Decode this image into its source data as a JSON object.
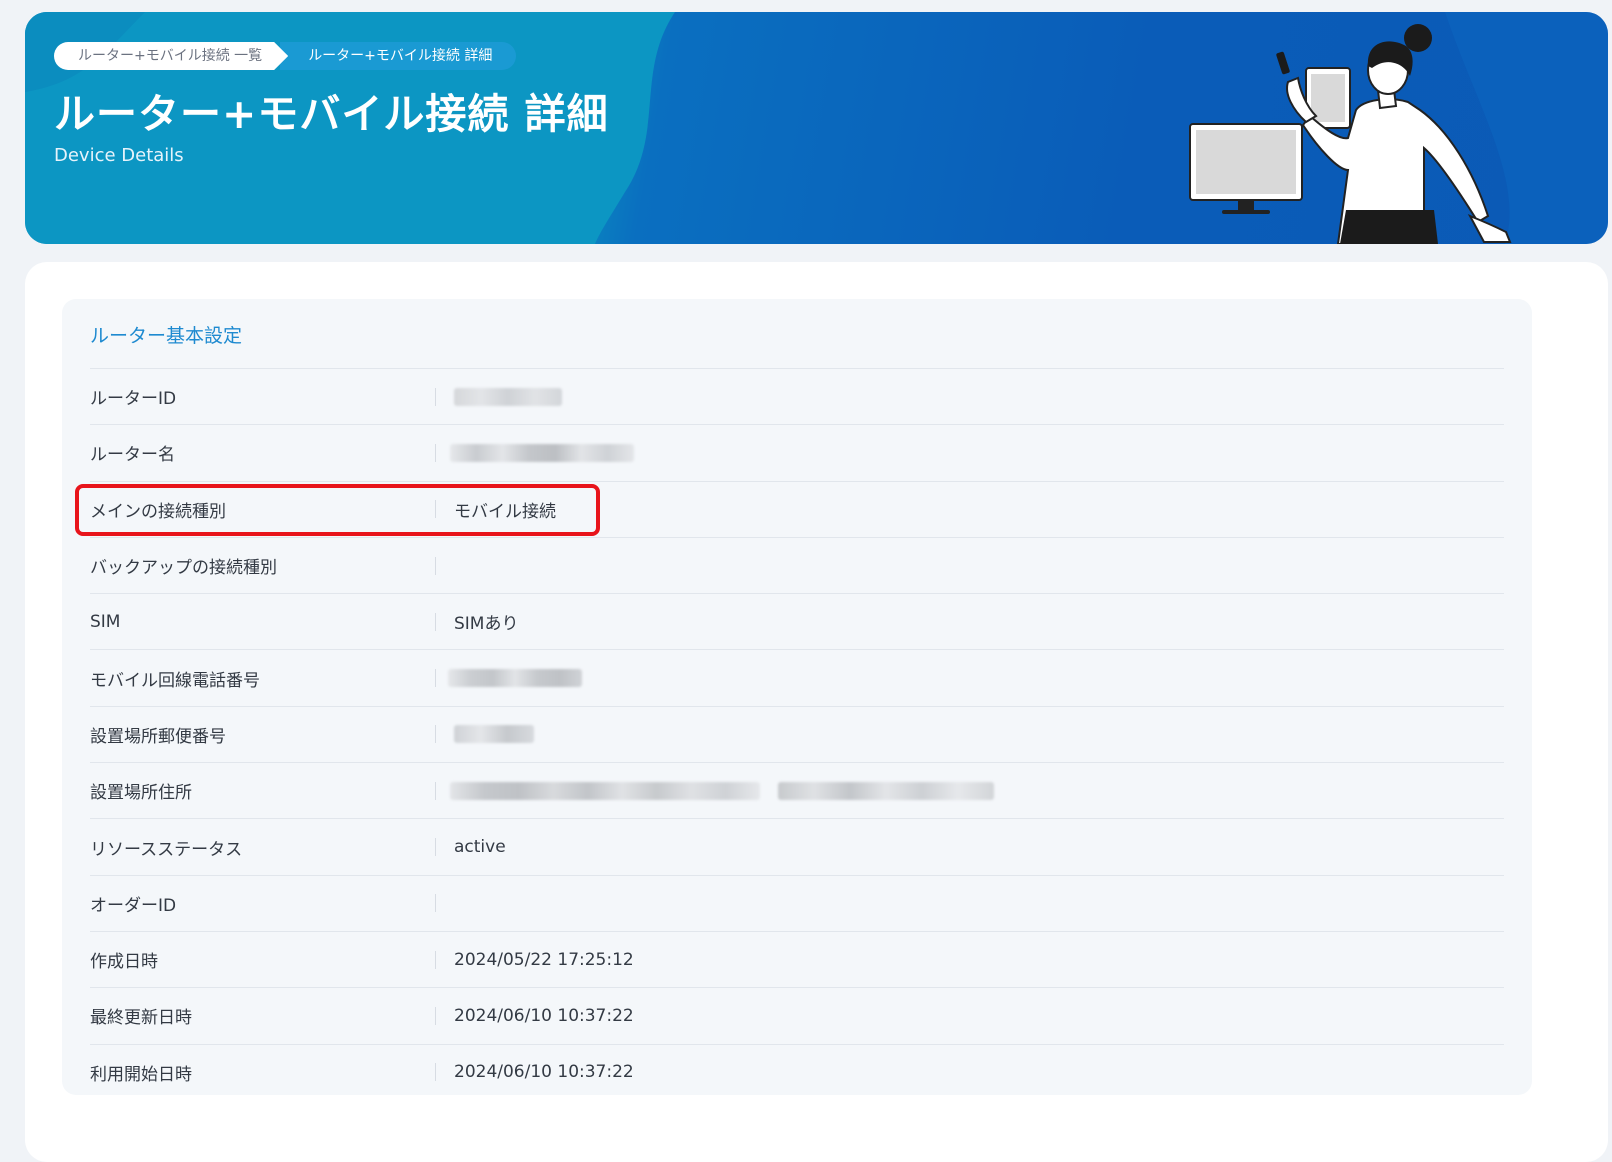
{
  "breadcrumb": {
    "items": [
      {
        "label": "ルーター+モバイル接続 一覧"
      },
      {
        "label": "ルーター+モバイル接続 詳細"
      }
    ]
  },
  "header": {
    "title": "ルーター+モバイル接続 詳細",
    "subtitle": "Device Details"
  },
  "section": {
    "title": "ルーター基本設定"
  },
  "rows": [
    {
      "label": "ルーターID",
      "value": ""
    },
    {
      "label": "ルーター名",
      "value": ""
    },
    {
      "label": "メインの接続種別",
      "value": "モバイル接続"
    },
    {
      "label": "バックアップの接続種別",
      "value": ""
    },
    {
      "label": "SIM",
      "value": "SIMあり"
    },
    {
      "label": "モバイル回線電話番号",
      "value": ""
    },
    {
      "label": "設置場所郵便番号",
      "value": ""
    },
    {
      "label": "設置場所住所",
      "value": ""
    },
    {
      "label": "リソースステータス",
      "value": "active"
    },
    {
      "label": "オーダーID",
      "value": ""
    },
    {
      "label": "作成日時",
      "value": "2024/05/22 17:25:12"
    },
    {
      "label": "最終更新日時",
      "value": "2024/06/10 10:37:22"
    },
    {
      "label": "利用開始日時",
      "value": "2024/06/10 10:37:22"
    }
  ],
  "colors": {
    "accent": "#1e8ad0",
    "header_blue": "#0a5cb8",
    "highlight": "#e8141b"
  }
}
